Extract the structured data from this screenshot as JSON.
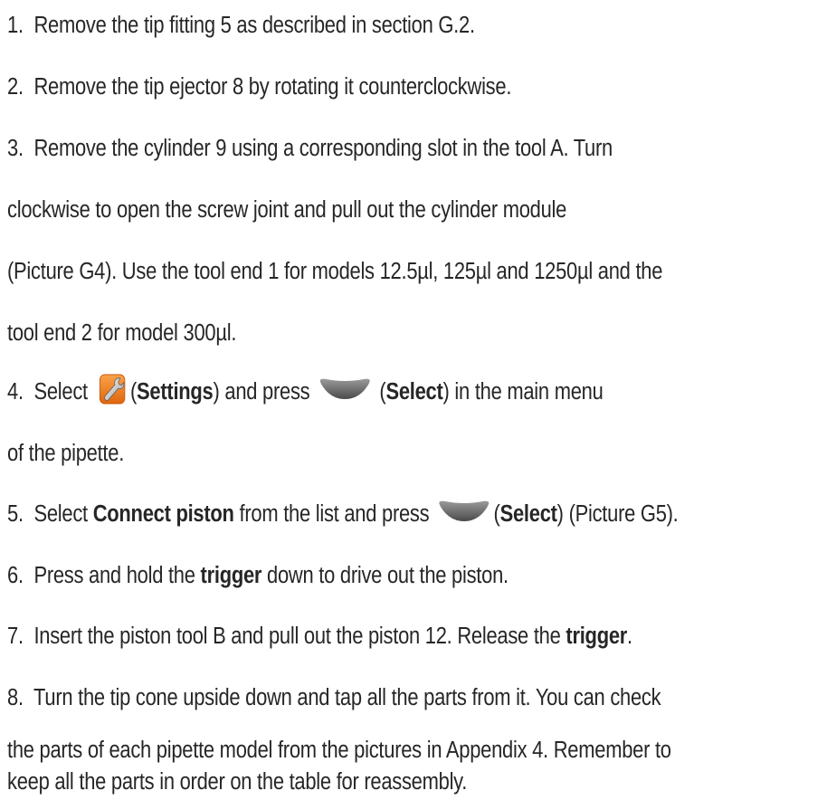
{
  "steps": [
    {
      "num": "1.",
      "text": "Remove the tip fitting 5 as described in section G.2."
    },
    {
      "num": "2.",
      "text": "Remove the tip ejector 8 by rotating it counterclockwise."
    },
    {
      "num": "3.",
      "lines": [
        "Remove the cylinder 9 using a corresponding slot in the tool A. Turn",
        "clockwise to open the screw joint and pull out the cylinder module",
        "(Picture G4). Use the tool end 1 for models 12.5µl, 125µl and 1250µl and the",
        "tool end 2 for model 300µl."
      ]
    },
    {
      "num": "4.",
      "t1": "Select",
      "icon_settings": "settings-wrench-icon",
      "b1": "Settings",
      "t2": "and press",
      "icon_select": "select-softkey-icon",
      "b2": "Select",
      "t3": ") in the main menu",
      "line2": "of the pipette."
    },
    {
      "num": "5.",
      "t1": "Select",
      "b1": "Connect piston",
      "t2": "from the list and press",
      "icon_select": "select-softkey-icon",
      "b2": "Select",
      "t3": "(Picture G5)."
    },
    {
      "num": "6.",
      "t1": "Press and hold the",
      "b1": "trigger",
      "t2": "down to drive out the piston."
    },
    {
      "num": "7.",
      "t1": "Insert the piston tool B and pull out the piston 12. Release the",
      "b1": "trigger",
      "t2": "."
    },
    {
      "num": "8.",
      "lines": [
        "Turn the tip cone upside down and tap all the parts from it. You can check",
        "the parts of each pipette model from the pictures in Appendix 4. Remember to",
        "keep all the parts in order on the table for reassembly."
      ]
    }
  ],
  "colors": {
    "text": "#262626",
    "settings_icon_orange": "#f07c1f",
    "select_key_gray": "#6e6e6e"
  }
}
